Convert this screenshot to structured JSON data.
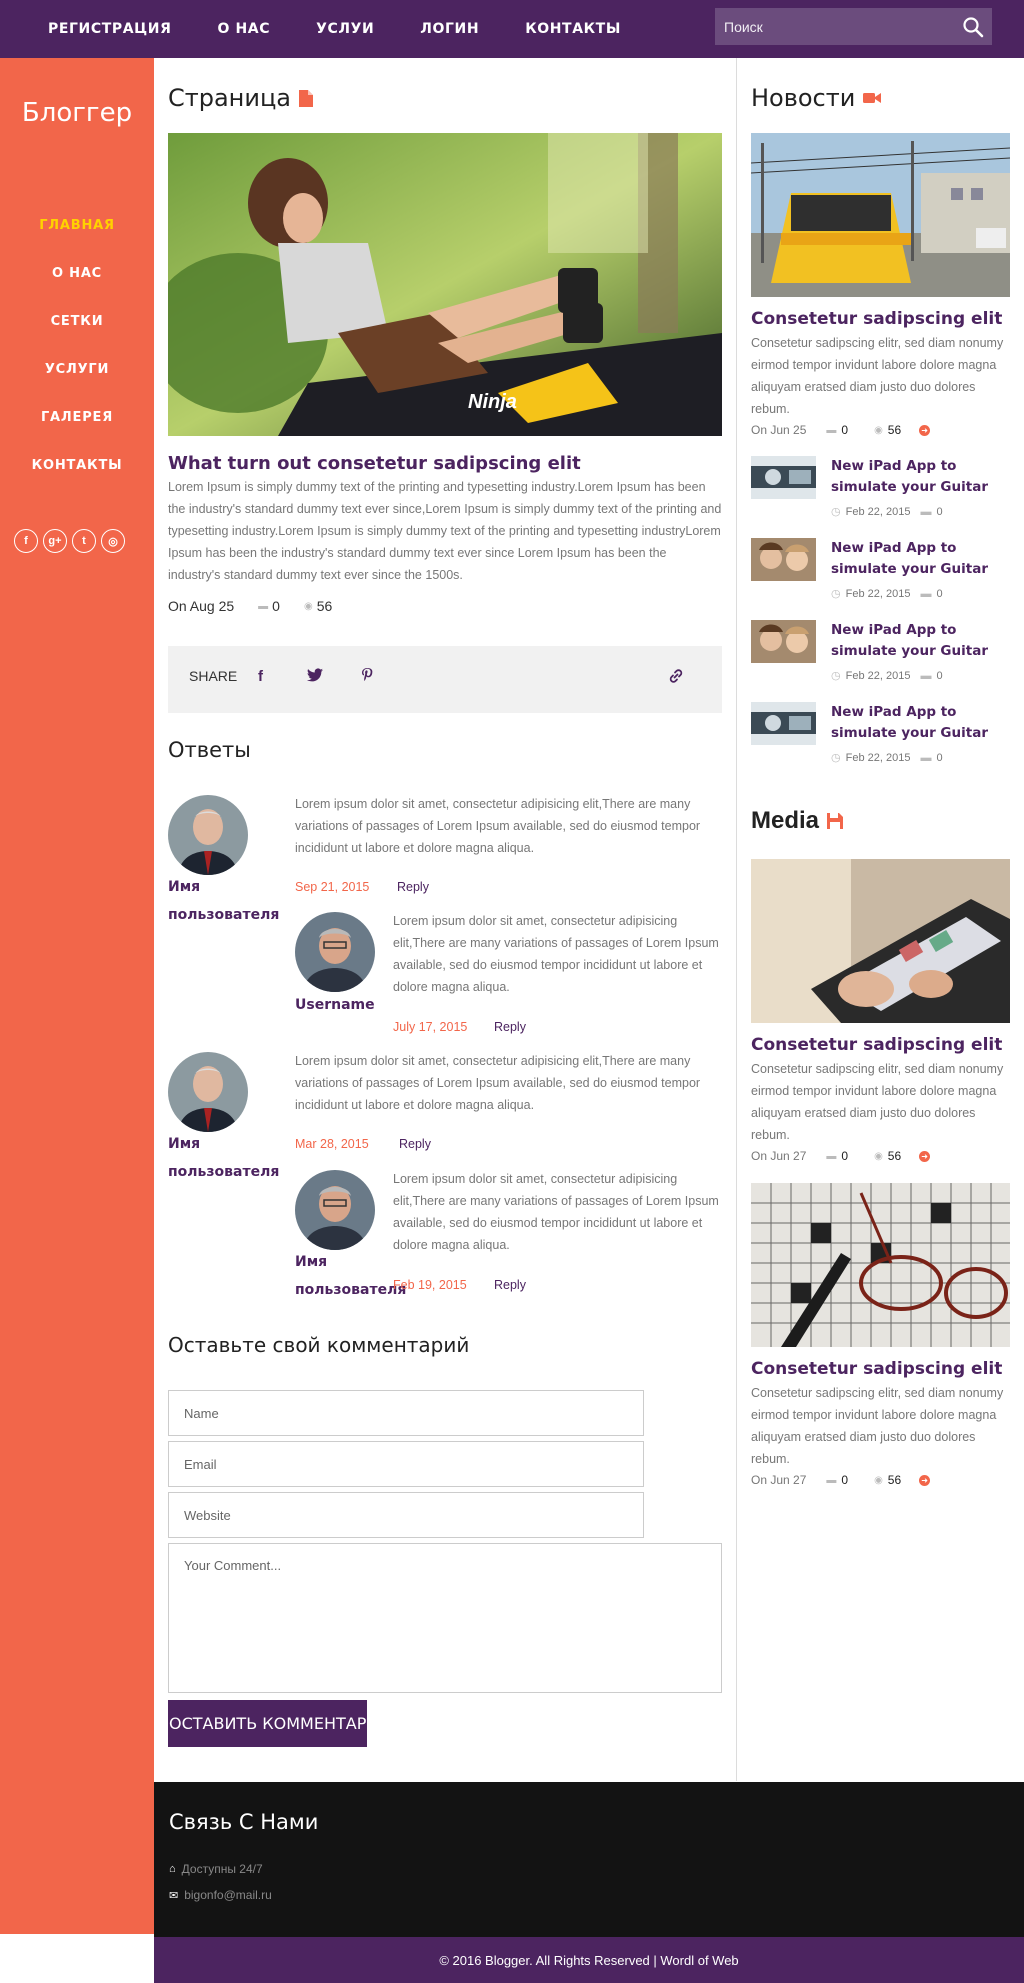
{
  "topnav": {
    "items": [
      "РЕГИСТРАЦИЯ",
      "О НАС",
      "УСЛУИ",
      "ЛОГИН",
      "КОНТАКТЫ"
    ],
    "search_placeholder": "Поиск"
  },
  "sidebar": {
    "brand": "Блоггер",
    "items": [
      "ГЛАВНАЯ",
      "О НАС",
      "СЕТКИ",
      "УСЛУГИ",
      "ГАЛЕРЕЯ",
      "КОНТАКТЫ"
    ],
    "active_item": "ГЛАВНАЯ"
  },
  "main": {
    "heading": "Страница",
    "post": {
      "title": "What turn out consetetur sadipscing elit",
      "body": "Lorem Ipsum is simply dummy text of the printing and typesetting industry.Lorem Ipsum has been the industry's standard dummy text ever since,Lorem Ipsum is simply dummy text of the printing and typesetting industry.Lorem Ipsum is simply dummy text of the printing and typesetting industryLorem Ipsum has been the industry's standard dummy text ever since Lorem Ipsum has been the industry's standard dummy text ever since the 1500s.",
      "date": "On Aug 25",
      "comments": "0",
      "views": "56"
    },
    "share_label": "SHARE",
    "answers_heading": "Ответы",
    "comments": [
      {
        "name": "Имя пользователя",
        "text": "Lorem ipsum dolor sit amet, consectetur adipisicing elit,There are many variations of passages of Lorem Ipsum available, sed do eiusmod tempor incididunt ut labore et dolore magna aliqua.",
        "date": "Sep 21, 2015",
        "reply": "Reply"
      },
      {
        "name": "Username",
        "text": "Lorem ipsum dolor sit amet, consectetur adipisicing elit,There are many variations of passages of Lorem Ipsum available, sed do eiusmod tempor incididunt ut labore et dolore magna aliqua.",
        "date": "July 17, 2015",
        "reply": "Reply"
      },
      {
        "name": "Имя пользователя",
        "text": "Lorem ipsum dolor sit amet, consectetur adipisicing elit,There are many variations of passages of Lorem Ipsum available, sed do eiusmod tempor incididunt ut labore et dolore magna aliqua.",
        "date": "Mar 28, 2015",
        "reply": "Reply"
      },
      {
        "name": "Имя пользователя",
        "text": "Lorem ipsum dolor sit amet, consectetur adipisicing elit,There are many variations of passages of Lorem Ipsum available, sed do eiusmod tempor incididunt ut labore et dolore magna aliqua.",
        "date": "Feb 19, 2015",
        "reply": "Reply"
      }
    ],
    "leave_heading": "Оставьте свой комментарий",
    "form": {
      "name_placeholder": "Name",
      "email_placeholder": "Email",
      "website_placeholder": "Website",
      "comment_placeholder": "Your Comment...",
      "submit": "ОСТАВИТЬ КОММЕНТАРИЙ"
    }
  },
  "right": {
    "news_heading": "Новости",
    "news_card": {
      "title": "Consetetur sadipscing elit",
      "body": "Consetetur sadipscing elitr, sed diam nonumy eirmod tempor invidunt labore dolore magna aliquyam eratsed diam justo duo dolores rebum.",
      "date": "On Jun 25",
      "comments": "0",
      "views": "56"
    },
    "mini_posts": [
      {
        "title": "New iPad App to simulate your Guitar",
        "date": "Feb 22, 2015",
        "count": "0"
      },
      {
        "title": "New iPad App to simulate your Guitar",
        "date": "Feb 22, 2015",
        "count": "0"
      },
      {
        "title": "New iPad App to simulate your Guitar",
        "date": "Feb 22, 2015",
        "count": "0"
      },
      {
        "title": "New iPad App to simulate your Guitar",
        "date": "Feb 22, 2015",
        "count": "0"
      }
    ],
    "media_heading": "Media",
    "media_cards": [
      {
        "title": "Consetetur sadipscing elit",
        "body": "Consetetur sadipscing elitr, sed diam nonumy eirmod tempor invidunt labore dolore magna aliquyam eratsed diam justo duo dolores rebum.",
        "date": "On Jun 27",
        "comments": "0",
        "views": "56"
      },
      {
        "title": "Consetetur sadipscing elit",
        "body": "Consetetur sadipscing elitr, sed diam nonumy eirmod tempor invidunt labore dolore magna aliquyam eratsed diam justo duo dolores rebum.",
        "date": "On Jun 27",
        "comments": "0",
        "views": "56"
      }
    ]
  },
  "footer": {
    "heading": "Связь С Нами",
    "availability": "Доступны 24/7",
    "email": "bigonfo@mail.ru",
    "copyright": "© 2016 Blogger. All Rights Reserved | Wordl of Web"
  },
  "colors": {
    "purple": "#4c2460",
    "orange": "#f2664a",
    "active": "#ffd200",
    "footer": "#131313"
  }
}
